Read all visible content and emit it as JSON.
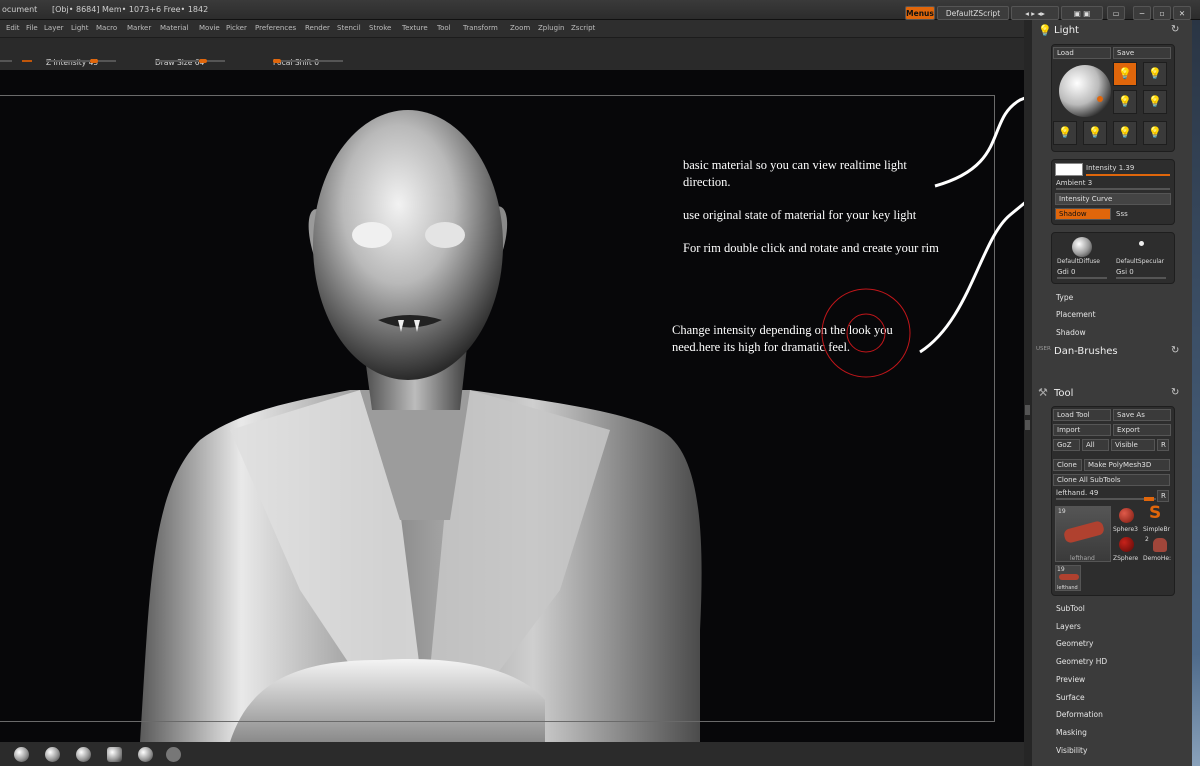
{
  "titlebar": {
    "doc": "ocument",
    "stats": "[Obj• 8684]  Mem• 1073+6  Free• 1842",
    "menus_btn": "Menus",
    "script_btn": "DefaultZScript"
  },
  "menu": [
    "Edit",
    "File",
    "Layer",
    "Light",
    "Macro",
    "Marker",
    "Material",
    "Movie",
    "Picker",
    "Preferences",
    "Render",
    "Stencil",
    "Stroke",
    "Texture",
    "Tool",
    "Transform",
    "Zoom",
    "Zplugin",
    "Zscript"
  ],
  "toolbar": {
    "z_intensity": {
      "label": "Z Intensity",
      "value": "45",
      "level": 0.45
    },
    "draw_size": {
      "label": "Draw Size",
      "value": "64",
      "level": 0.45
    },
    "focal_shift": {
      "label": "Focal Shift",
      "value": "0",
      "level": 0.0
    }
  },
  "annotations": {
    "line1": "basic material so you can view realtime light",
    "line2": "direction.",
    "line3": "use original state of material for your key light",
    "line4": "For rim double click and rotate and create your rim",
    "line5": "Change intensity depending on the look you",
    "line6": "need.here its high for dramatic feel."
  },
  "light": {
    "title": "Light",
    "load": "Load",
    "save": "Save",
    "intensity": "Intensity 1.39",
    "ambient": "Ambient 3",
    "curve": "Intensity Curve",
    "shadow": "Shadow",
    "sss": "Sss",
    "diffuse": "DefaultDiffuse",
    "specular": "DefaultSpecular",
    "gdi": "Gdi 0",
    "gsi": "Gsi 0",
    "type": "Type",
    "placement": "Placement",
    "shadow_sub": "Shadow"
  },
  "user_label": "USER",
  "dan_brushes": "Dan-Brushes",
  "tool": {
    "title": "Tool",
    "load_tool": "Load Tool",
    "save_as": "Save As",
    "import": "Import",
    "export": "Export",
    "goz": "GoZ",
    "all": "All",
    "visible": "Visible",
    "r": "R",
    "clone": "Clone",
    "make_polymesh": "Make PolyMesh3D",
    "clone_all": "Clone All SubTools",
    "current": "lefthand. 49",
    "count": "19",
    "count2": "2",
    "thumb_main": "lefthand",
    "sphere3": "Sphere3",
    "simplebr": "SimpleBr",
    "zsphere": "ZSphere",
    "demohe": "DemoHe:",
    "thumb_small": "lefthand"
  },
  "tool_subs": [
    "SubTool",
    "Layers",
    "Geometry",
    "Geometry HD",
    "Preview",
    "Surface",
    "Deformation",
    "Masking",
    "Visibility"
  ],
  "colors": {
    "accent": "#e0660b",
    "panel": "#3b3b3b"
  }
}
